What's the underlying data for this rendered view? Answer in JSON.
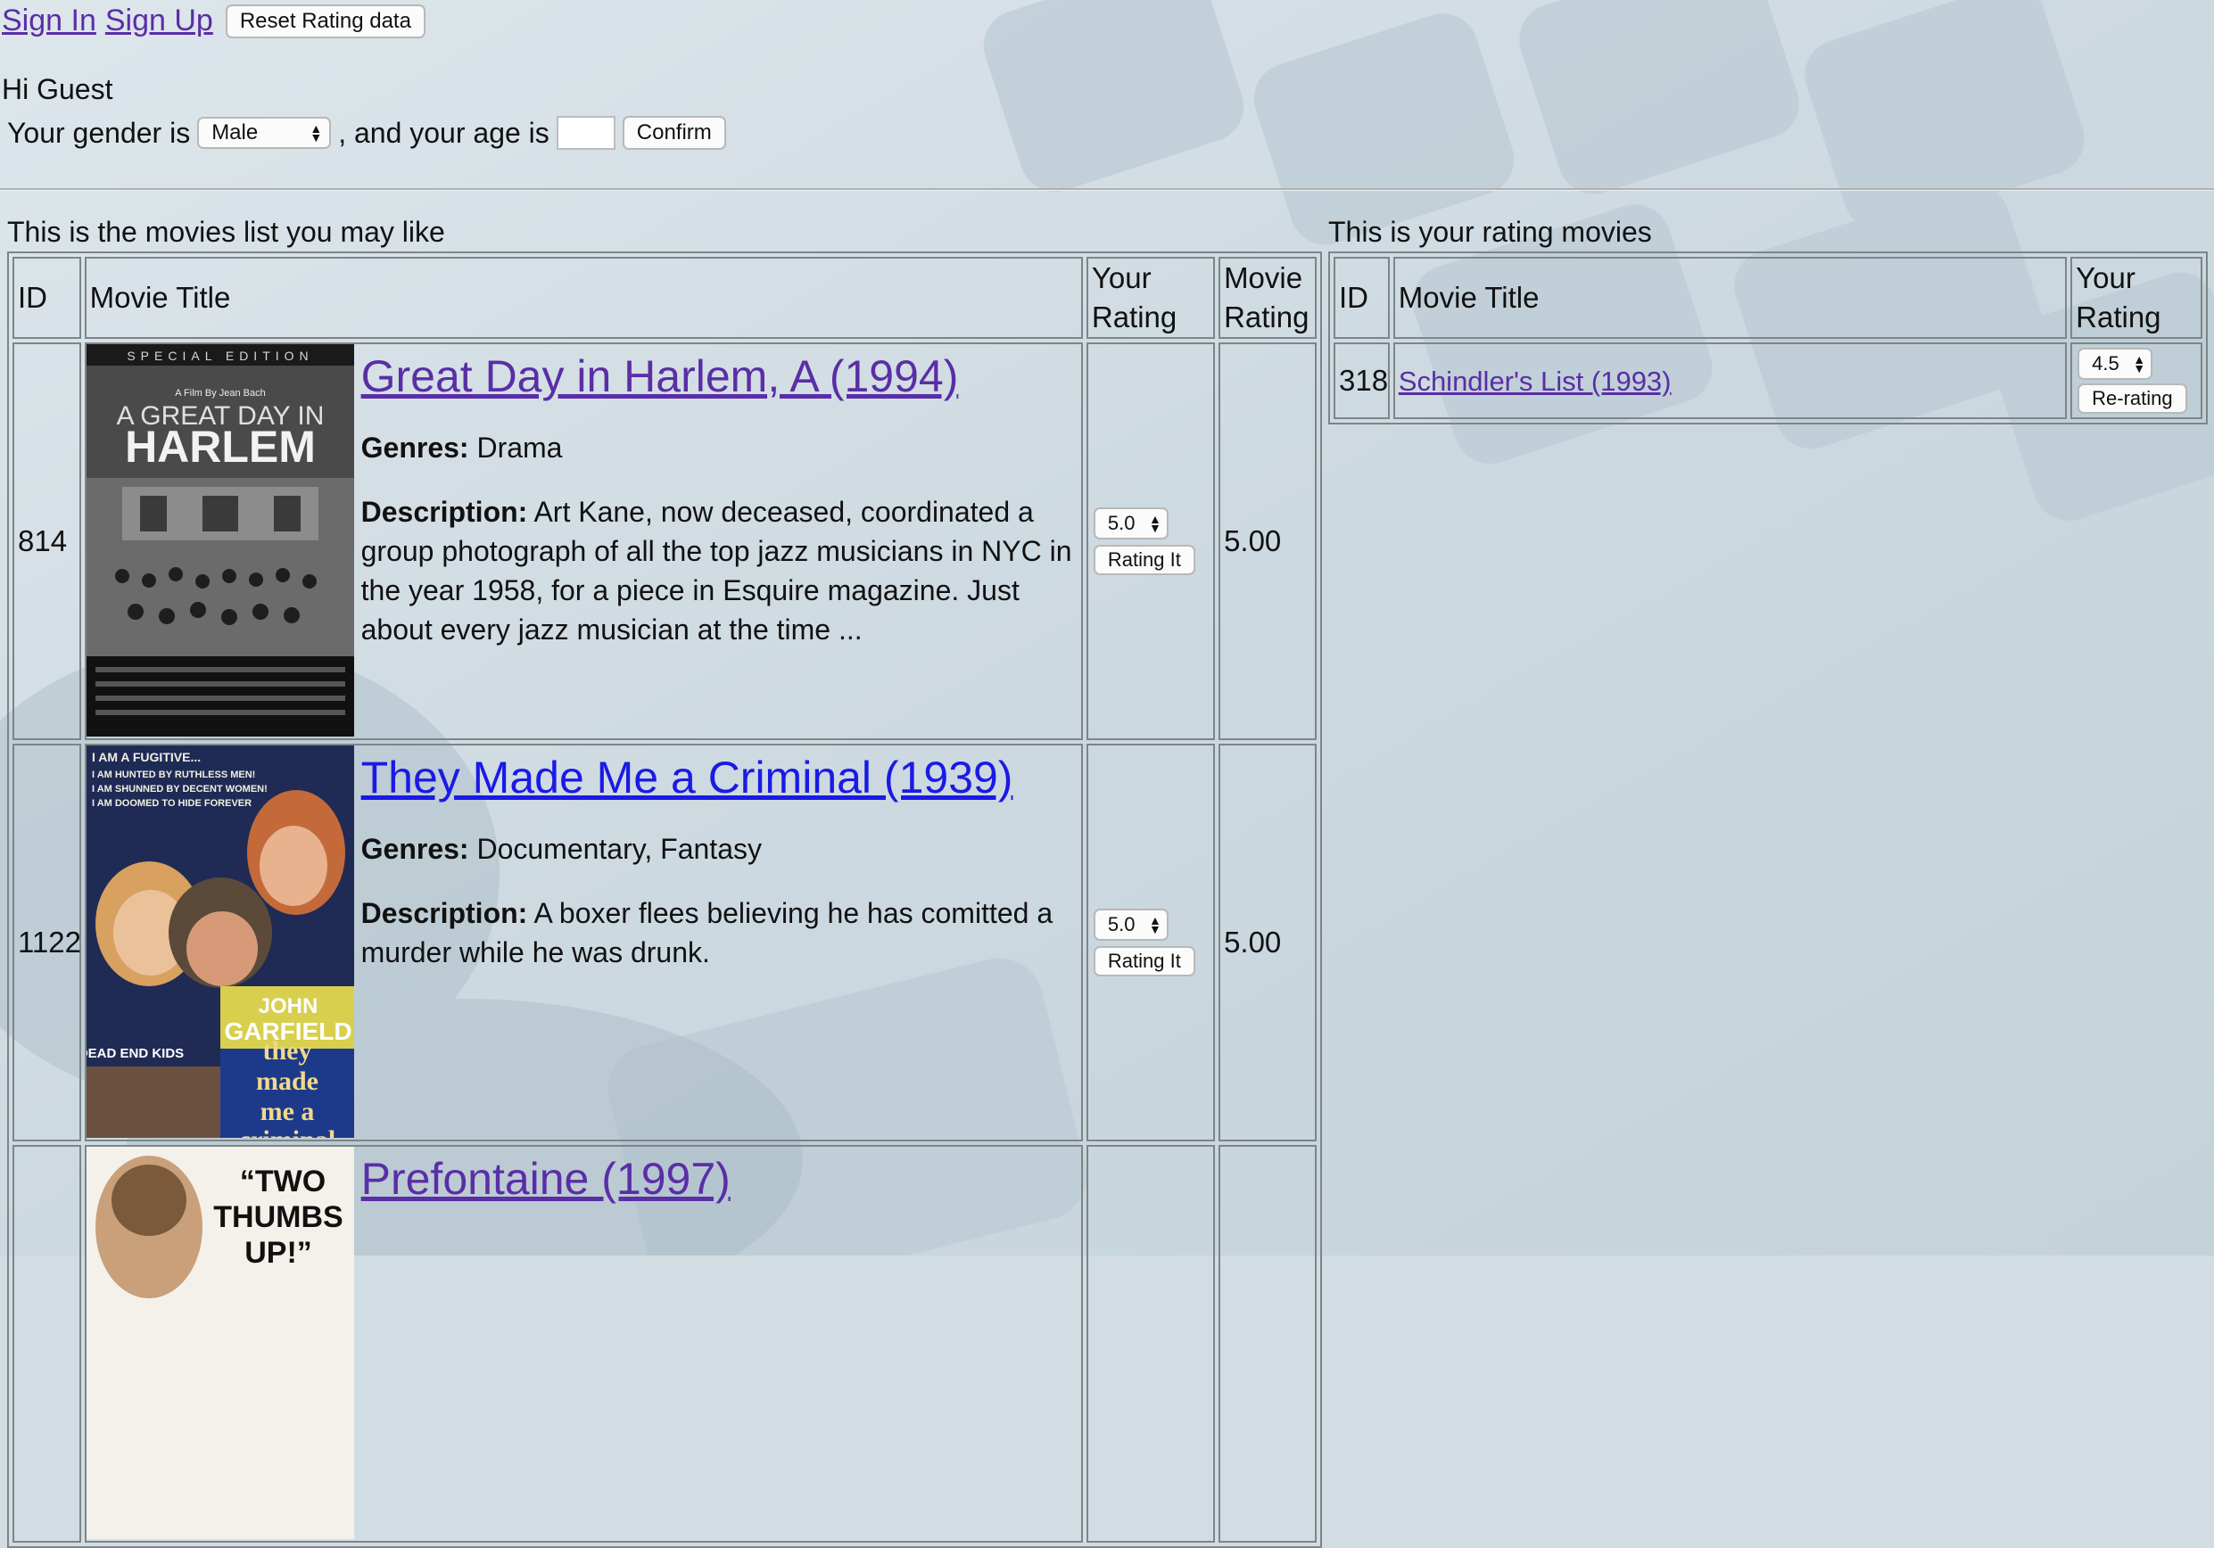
{
  "nav": {
    "sign_in": "Sign In",
    "sign_up": "Sign Up",
    "reset": "Reset Rating data"
  },
  "profile": {
    "greeting": "Hi Guest",
    "gender_prefix": "Your gender is",
    "gender_value": "Male",
    "age_text": ", and your age is",
    "age_value": "",
    "confirm": "Confirm"
  },
  "recommend": {
    "caption": "This is the movies list you may like",
    "headers": {
      "id": "ID",
      "title": "Movie Title",
      "your_rating_1": "Your",
      "your_rating_2": "Rating",
      "movie_rating_1": "Movie",
      "movie_rating_2": "Rating"
    },
    "rows": [
      {
        "id": "814",
        "title": "Great Day in Harlem, A (1994)",
        "genres_label": "Genres:",
        "genres": "Drama",
        "desc_label": "Description:",
        "description": "Art Kane, now deceased, coordinated a group photograph of all the top jazz musicians in NYC in the year 1958, for a piece in Esquire magazine. Just about every jazz musician at the time ...",
        "your_rating": "5.0",
        "rate_button": "Rating It",
        "movie_rating": "5.00",
        "poster": {
          "top": "SPECIAL EDITION",
          "line1": "A GREAT DAY IN",
          "line2": "HARLEM",
          "by": "A Film By Jean Bach"
        }
      },
      {
        "id": "1122",
        "title": "They Made Me a Criminal (1939)",
        "genres_label": "Genres:",
        "genres": "Documentary, Fantasy",
        "desc_label": "Description:",
        "description": "A boxer flees believing he has comitted a murder while he was drunk.",
        "your_rating": "5.0",
        "rate_button": "Rating It",
        "movie_rating": "5.00",
        "poster": {
          "tag1": "I AM A FUGITIVE...",
          "tag2": "I AM HUNTED BY RUTHLESS MEN!",
          "tag3": "I AM SHUNNED BY DECENT WOMEN!",
          "tag4": "I AM DOOMED TO HIDE FOREVER",
          "star1": "JOHN",
          "star2": "GARFIELD",
          "kids": "DEAD END KIDS",
          "t1": "they",
          "t2": "made",
          "t3": "me a",
          "t4": "criminal"
        }
      },
      {
        "id": "",
        "title": "Prefontaine (1997)",
        "poster": {
          "q1": "“TWO",
          "q2": "THUMBS",
          "q3": "UP!”"
        }
      }
    ]
  },
  "rated": {
    "caption": "This is your rating movies",
    "headers": {
      "id": "ID",
      "title": "Movie Title",
      "your_rating_1": "Your",
      "your_rating_2": "Rating"
    },
    "rows": [
      {
        "id": "318",
        "title": "Schindler's List (1993)",
        "your_rating": "4.5",
        "rerate_button": "Re-rating"
      }
    ]
  },
  "icons": {
    "select_arrows": "updown-arrows-icon"
  }
}
